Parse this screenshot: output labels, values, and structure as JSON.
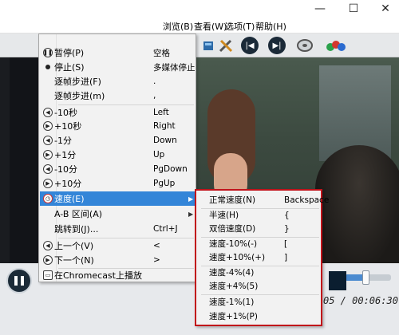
{
  "window": {
    "minimize_glyph": "—",
    "maximize_glyph": "☐",
    "close_glyph": "✕"
  },
  "menubar": {
    "items": [
      "浏览(B)",
      "查看(W)",
      "选项(T)",
      "帮助(H)"
    ]
  },
  "context_menu": {
    "items": [
      {
        "label": "暂停(P)",
        "shortcut": "空格",
        "icon": "pause-circle-icon"
      },
      {
        "label": "停止(S)",
        "shortcut": "多媒体停止",
        "icon": "radio-dot-icon"
      },
      {
        "label": "逐帧步进(F)",
        "shortcut": "."
      },
      {
        "label": "逐帧步进(m)",
        "shortcut": ","
      },
      {
        "label": "-10秒",
        "shortcut": "Left",
        "icon": "rewind-circle-icon"
      },
      {
        "label": "+10秒",
        "shortcut": "Right",
        "icon": "forward-circle-icon"
      },
      {
        "label": "-1分",
        "shortcut": "Down",
        "icon": "rewind-circle-icon"
      },
      {
        "label": "+1分",
        "shortcut": "Up",
        "icon": "forward-circle-icon"
      },
      {
        "label": "-10分",
        "shortcut": "PgDown",
        "icon": "rewind-circle-icon"
      },
      {
        "label": "+10分",
        "shortcut": "PgUp",
        "icon": "forward-circle-icon"
      },
      {
        "label": "速度(E)",
        "shortcut": "",
        "icon": "speed-clock-icon",
        "submenu": true,
        "highlighted": true
      },
      {
        "label": "A-B 区间(A)",
        "shortcut": "",
        "submenu": true
      },
      {
        "label": "跳转到(J)...",
        "shortcut": "Ctrl+J"
      },
      {
        "label": "上一个(V)",
        "shortcut": "<",
        "icon": "previous-circle-icon"
      },
      {
        "label": "下一个(N)",
        "shortcut": ">",
        "icon": "next-circle-icon"
      },
      {
        "label": "在Chromecast上播放",
        "shortcut": "",
        "icon": "cast-icon"
      }
    ]
  },
  "speed_submenu": {
    "items": [
      {
        "label": "正常速度(N)",
        "shortcut": "Backspace"
      },
      {
        "label": "半速(H)",
        "shortcut": "{"
      },
      {
        "label": "双倍速度(D)",
        "shortcut": "}"
      },
      {
        "label": "速度-10%(-)",
        "shortcut": "["
      },
      {
        "label": "速度+10%(+)",
        "shortcut": "]"
      },
      {
        "label": "速度-4%(4)",
        "shortcut": ""
      },
      {
        "label": "速度+4%(5)",
        "shortcut": ""
      },
      {
        "label": "速度-1%(1)",
        "shortcut": ""
      },
      {
        "label": "速度+1%(P)",
        "shortcut": ""
      }
    ]
  },
  "player": {
    "timecode": "05 / 00:06:30",
    "volume_fraction": 0.45
  },
  "colors": {
    "menu_highlight": "#3385d8",
    "submenu_border": "#c1121a",
    "video_bg": "#121418"
  }
}
